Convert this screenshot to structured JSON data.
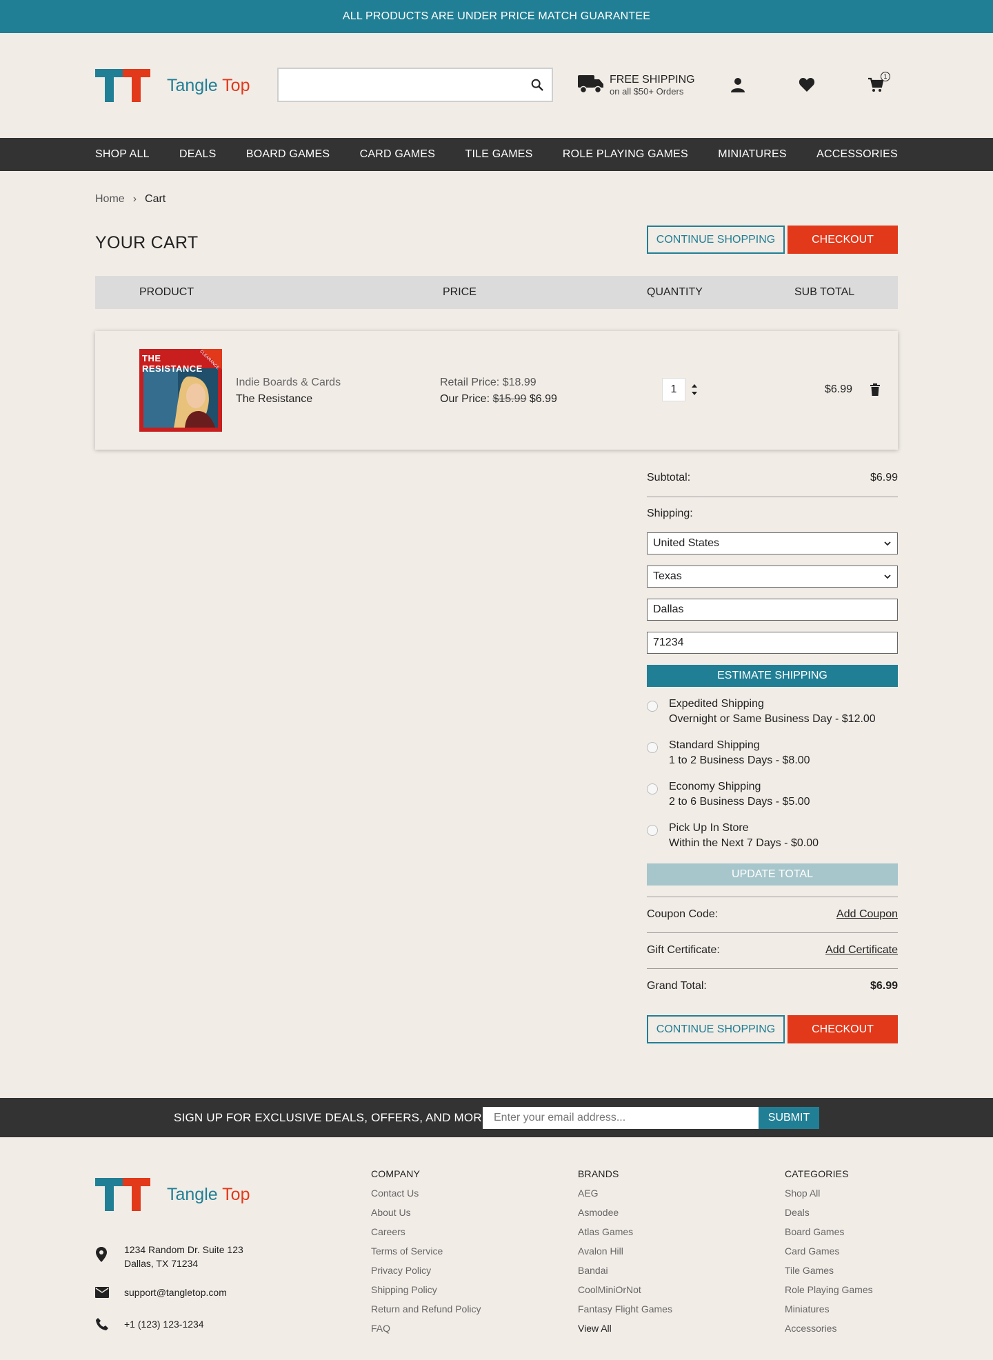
{
  "promo": {
    "text": "ALL PRODUCTS ARE UNDER PRICE MATCH GUARANTEE"
  },
  "brand": {
    "name_part1": "Tangle",
    "name_part2": "Top",
    "blue": "#217f95",
    "red": "#e2391b"
  },
  "search": {
    "value": "",
    "placeholder": "",
    "icon": "search-icon"
  },
  "free_shipping": {
    "title": "FREE SHIPPING",
    "subtitle": "on all $50+ Orders",
    "icon": "truck-icon"
  },
  "header_icons": {
    "account": "user-icon",
    "wishlist": "heart-icon",
    "cart": "cart-icon",
    "cart_count": "1"
  },
  "nav": [
    "SHOP ALL",
    "DEALS",
    "BOARD GAMES",
    "CARD GAMES",
    "TILE GAMES",
    "ROLE PLAYING GAMES",
    "MINIATURES",
    "ACCESSORIES"
  ],
  "breadcrumb": {
    "home": "Home",
    "separator": "›",
    "current": "Cart"
  },
  "cart": {
    "title": "YOUR CART",
    "continue_label": "CONTINUE SHOPPING",
    "checkout_label": "CHECKOUT",
    "columns": [
      "PRODUCT",
      "PRICE",
      "QUANTITY",
      "SUB TOTAL"
    ],
    "items": [
      {
        "brand": "Indie Boards & Cards",
        "name": "The Resistance",
        "image_title": "THE RESISTANCE",
        "image_tag": "CLEARANCE",
        "retail_label": "Retail Price:",
        "retail_price": "$18.99",
        "our_label": "Our Price:",
        "old_price": "$15.99",
        "price": "$6.99",
        "quantity": "1",
        "subtotal": "$6.99"
      }
    ]
  },
  "summary": {
    "subtotal_label": "Subtotal:",
    "subtotal_value": "$6.99",
    "shipping_label": "Shipping:",
    "country": "United States",
    "state": "Texas",
    "city": "Dallas",
    "zip": "71234",
    "estimate_label": "ESTIMATE SHIPPING",
    "options": [
      {
        "name": "Expedited Shipping",
        "desc": "Overnight or Same Business Day - $12.00"
      },
      {
        "name": "Standard Shipping",
        "desc": "1 to 2 Business Days - $8.00"
      },
      {
        "name": "Economy Shipping",
        "desc": "2 to 6 Business Days - $5.00"
      },
      {
        "name": "Pick Up In Store",
        "desc": "Within the Next 7 Days - $0.00"
      }
    ],
    "update_label": "UPDATE TOTAL",
    "coupon_label": "Coupon Code:",
    "coupon_link": "Add Coupon",
    "gift_label": "Gift Certificate:",
    "gift_link": "Add Certificate",
    "grand_label": "Grand Total:",
    "grand_value": "$6.99"
  },
  "signup": {
    "text": "SIGN UP FOR EXCLUSIVE DEALS, OFFERS, AND MORE!",
    "placeholder": "Enter your email address...",
    "button": "SUBMIT"
  },
  "footer": {
    "address_line1": "1234 Random Dr. Suite 123",
    "address_line2": "Dallas, TX 71234",
    "email": "support@tangletop.com",
    "phone": "+1 (123) 123-1234",
    "company": {
      "heading": "COMPANY",
      "links": [
        "Contact Us",
        "About Us",
        "Careers",
        "Terms of Service",
        "Privacy Policy",
        "Shipping Policy",
        "Return and Refund Policy",
        "FAQ"
      ]
    },
    "brands": {
      "heading": "BRANDS",
      "links": [
        "AEG",
        "Asmodee",
        "Atlas Games",
        "Avalon Hill",
        "Bandai",
        "CoolMiniOrNot",
        "Fantasy Flight Games",
        "View All"
      ]
    },
    "categories": {
      "heading": "CATEGORIES",
      "links": [
        "Shop All",
        "Deals",
        "Board Games",
        "Card Games",
        "Tile Games",
        "Role Playing Games",
        "Miniatures",
        "Accessories"
      ]
    }
  }
}
